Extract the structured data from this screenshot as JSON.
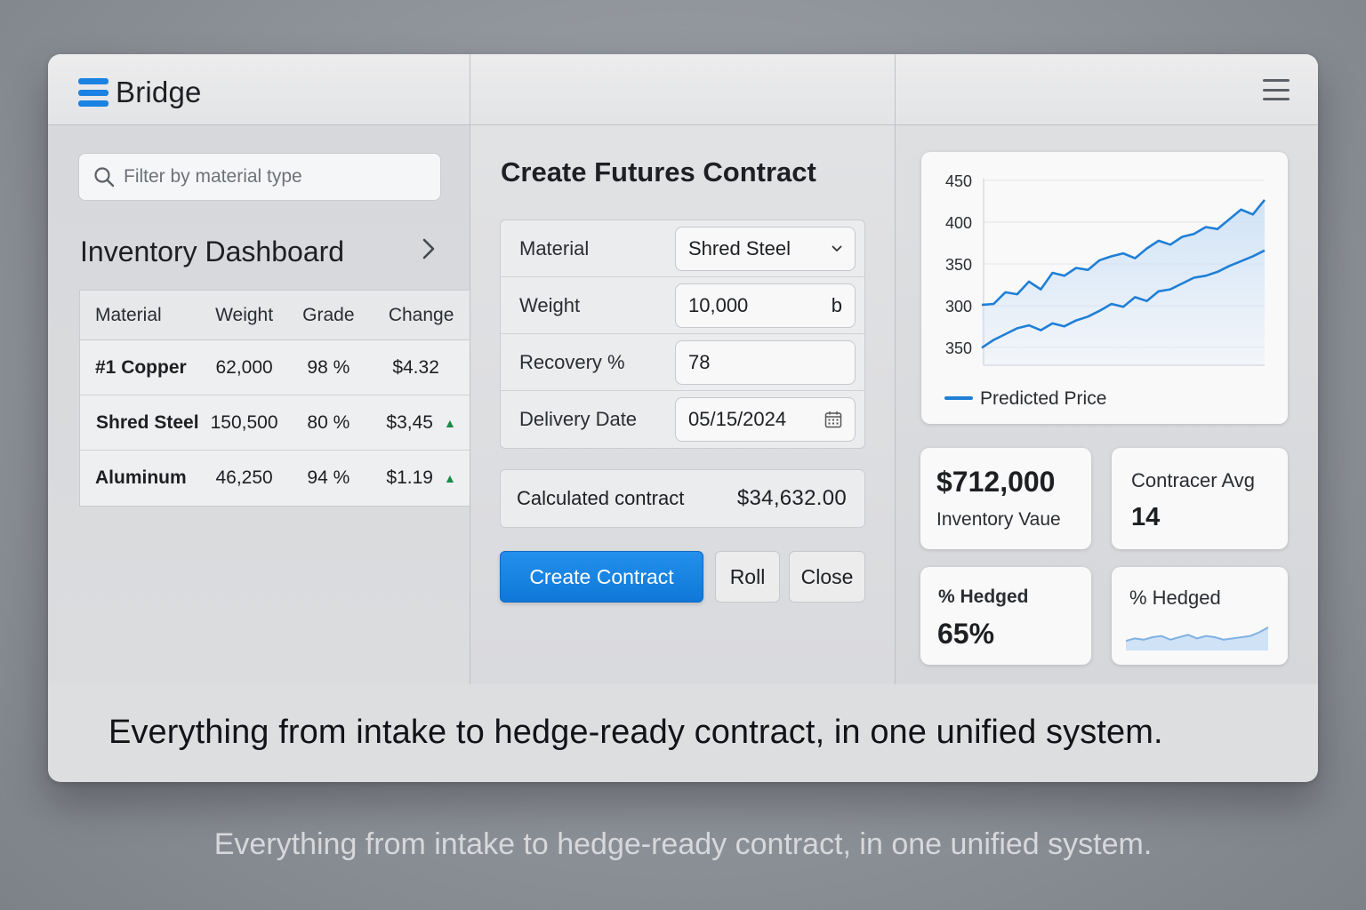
{
  "app": {
    "brand": "Bridge"
  },
  "sidebar": {
    "search_placeholder": "Filter by material type",
    "title": "Inventory Dashboard",
    "table": {
      "headers": [
        "Material",
        "Weight",
        "Grade",
        "Change"
      ],
      "rows": [
        {
          "material": "#1 Copper",
          "weight": "62,000",
          "grade": "98 %",
          "change": "$4.32",
          "trend": ""
        },
        {
          "material": "Shred Steel",
          "weight": "150,500",
          "grade": "80 %",
          "change": "$3,45",
          "trend": "▲"
        },
        {
          "material": "Aluminum",
          "weight": "46,250",
          "grade": "94 %",
          "change": "$1.19",
          "trend": "▲"
        }
      ]
    }
  },
  "form": {
    "title": "Create Futures Contract",
    "fields": [
      {
        "label": "Material",
        "value": "Shred Steel",
        "suffix": "⌄"
      },
      {
        "label": "Weight",
        "value": "10,000",
        "suffix": "b"
      },
      {
        "label": "Recovery %",
        "value": "78",
        "suffix": ""
      },
      {
        "label": "Delivery Date",
        "value": "05/15/2024",
        "suffix": ""
      }
    ],
    "calculated_label": "Calculated contract",
    "calculated_value": "$34,632.00",
    "buttons": {
      "create": "Create Contract",
      "roll": "Roll",
      "close": "Close"
    }
  },
  "chart_data": {
    "type": "area",
    "title": "",
    "xlabel": "",
    "ylabel": "",
    "y_tick_labels": [
      "450",
      "400",
      "350",
      "300",
      "350"
    ],
    "legend": [
      "Predicted Price"
    ],
    "legend_position": "bottom-left",
    "grid": true,
    "series": [
      {
        "name": "Predicted Price",
        "values": [
          322,
          323,
          335,
          333,
          346,
          338,
          355,
          352,
          360,
          358,
          368,
          372,
          375,
          370,
          380,
          388,
          384,
          392,
          395,
          402,
          400,
          410,
          420,
          415,
          430
        ]
      },
      {
        "name": "",
        "values": [
          278,
          286,
          292,
          298,
          301,
          296,
          303,
          300,
          306,
          310,
          316,
          323,
          320,
          330,
          326,
          336,
          338,
          344,
          350,
          352,
          356,
          362,
          367,
          372,
          378
        ]
      }
    ],
    "color": "#1f7fd6",
    "fill_color": "#cfe2f6"
  },
  "kpis": {
    "inventory_value": "$712,000",
    "inventory_label": "Inventory Vaue",
    "contract_avg_label": "Contracer Avg",
    "contract_avg_value": "14",
    "hedged_label": "% Hedged",
    "hedged_value": "65%",
    "hedged_spark_label": "% Hedged",
    "hedged_spark_values": [
      5,
      7,
      6,
      8,
      9,
      6,
      8,
      10,
      7,
      9,
      8,
      6,
      7,
      8,
      9,
      12,
      16
    ]
  },
  "footer": {
    "tagline": "Everything from intake to hedge-ready contract, in one unified system."
  },
  "caption": "Everything from intake to hedge-ready contract, in one unified system."
}
